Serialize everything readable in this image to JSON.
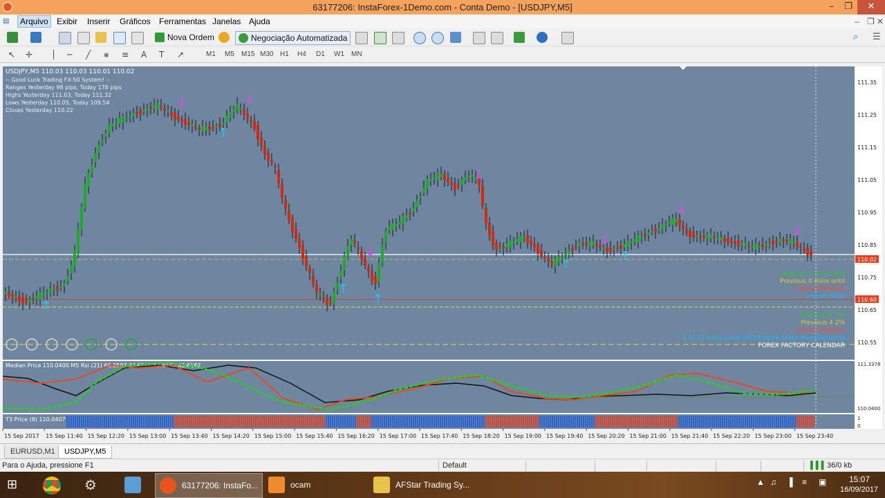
{
  "window": {
    "title": "63177206: InstaForex-1Demo.com - Conta Demo - [USDJPY,M5]"
  },
  "menu": [
    {
      "label": "Arquivo"
    },
    {
      "label": "Exibir"
    },
    {
      "label": "Inserir"
    },
    {
      "label": "Gráficos"
    },
    {
      "label": "Ferramentas"
    },
    {
      "label": "Janelas"
    },
    {
      "label": "Ajuda"
    }
  ],
  "toolbar": {
    "new_order": "Nova Ordem",
    "auto_trading": "Negociação Automatizada"
  },
  "timeframes": [
    "M1",
    "M5",
    "M15",
    "M30",
    "H1",
    "H4",
    "D1",
    "W1",
    "MN"
  ],
  "chart": {
    "header": "USDJPY,M5  110.03 110.03 110.01 110.02",
    "info_lines": [
      "-- Good Luck Trading FX-50 System! --",
      "Ranges Yesterday 98 pips, Today 178 pips",
      "Highs Yesterday 111.03, Today 111.32",
      "Lows Yesterday 110.05, Today 109.54",
      "Closes Yesterday 110.22"
    ],
    "price_ticks": [
      "111.35",
      "111.25",
      "111.15",
      "111.05",
      "110.95",
      "110.85",
      "110.75",
      "110.65",
      "110.55"
    ],
    "price_tags": [
      "110.02",
      "110.60"
    ],
    "right_panel": [
      {
        "text": "Previous 1 mins until",
        "color": "#22cc22"
      },
      {
        "text": "Previous 0 mins until",
        "color": "#e8c81c"
      },
      {
        "text": "Impact Medium",
        "color": "#ff4a2a"
      },
      {
        "text": "Impact High",
        "color": "#18b8ff"
      },
      {
        "text": "Previous 1.1%",
        "color": "#22cc22"
      },
      {
        "text": "Previous 4.2%",
        "color": "#e8c81c"
      },
      {
        "text": "Impact Medium",
        "color": "#ff4a2a"
      },
      {
        "text": "1 hr 12 mins since USD Empire State Manufacturing",
        "color": "#18b8ff"
      },
      {
        "text": "FOREX FACTORY CALENDAR",
        "color": "#ffffff"
      }
    ],
    "indicator1_label": "Median Price 110.0400  M5  Rsi (21) 60.0597 43.6182 43.6182 42.6182",
    "indicator1_ticks": [
      "111.3378",
      "110.0400"
    ],
    "indicator2_label": "T3 Price (8) 110.0407",
    "indicator2_ticks": [
      "1",
      "0"
    ],
    "time_labels": [
      "15 Sep 2017",
      "15 Sep 11:40",
      "15 Sep 12:20",
      "15 Sep 13:00",
      "15 Sep 13:40",
      "15 Sep 14:20",
      "15 Sep 15:00",
      "15 Sep 15:40",
      "15 Sep 16:20",
      "15 Sep 17:00",
      "15 Sep 17:40",
      "15 Sep 18:20",
      "15 Sep 19:00",
      "15 Sep 19:40",
      "15 Sep 20:20",
      "15 Sep 21:00",
      "15 Sep 21:40",
      "15 Sep 22:20",
      "15 Sep 23:00",
      "15 Sep 23:40"
    ],
    "colors": {
      "background": "#6f86a0",
      "bull": "#22a82a",
      "bear": "#d42a10",
      "buy_arrow": "#18c8f8",
      "sell_arrow": "#f040f0"
    }
  },
  "tabs": [
    {
      "label": "EURUSD,M1"
    },
    {
      "label": "USDJPY,M5"
    }
  ],
  "status": {
    "help": "Para o Ajuda, pressione F1",
    "profile": "Default",
    "traffic": "36/0 kb"
  },
  "taskbar": {
    "items": [
      {
        "label": "63177206: InstaFo..."
      },
      {
        "label": "ocam"
      },
      {
        "label": "AFStar Trading Sy..."
      }
    ],
    "time": "15:07",
    "date": "16/09/2017"
  }
}
